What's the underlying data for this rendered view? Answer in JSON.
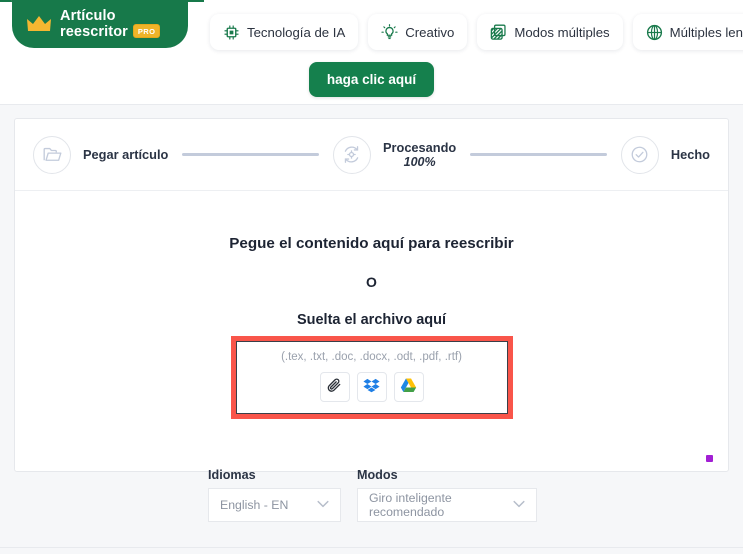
{
  "brand": {
    "crown_icon": "crown-icon",
    "line1": "Artículo",
    "line2": "reescritor",
    "badge": "PRO",
    "green": "#17794a",
    "badge_color": "#f0b429"
  },
  "header": {
    "pills": [
      {
        "icon": "ai-chip-icon",
        "label": "Tecnología de IA"
      },
      {
        "icon": "lightbulb-icon",
        "label": "Creativo"
      },
      {
        "icon": "layers-icon",
        "label": "Modos múltiples"
      },
      {
        "icon": "globe-icon",
        "label": "Múltiples lenguas"
      }
    ],
    "cta_label": "haga clic aquí",
    "cta_color": "#15804d"
  },
  "stepper": {
    "steps": [
      {
        "icon": "folder-icon",
        "label": "Pegar artículo",
        "sub": ""
      },
      {
        "icon": "processing-icon",
        "label": "Procesando",
        "sub": "100%"
      },
      {
        "icon": "check-circle-icon",
        "label": "Hecho",
        "sub": ""
      }
    ]
  },
  "dropzone": {
    "title": "Pegue el contenido aquí para reescribir",
    "or": "O",
    "subtitle": "Suelta el archivo aquí",
    "extensions": "(.tex, .txt, .doc, .docx, .odt, .pdf, .rtf)",
    "highlight_color": "#f9554a",
    "upload_buttons": [
      {
        "icon": "paperclip-icon",
        "name": "attach-file-button"
      },
      {
        "icon": "dropbox-icon",
        "name": "dropbox-button"
      },
      {
        "icon": "google-drive-icon",
        "name": "google-drive-button"
      }
    ],
    "marker_color": "#a21fd4"
  },
  "controls": {
    "language": {
      "label": "Idiomas",
      "value": "English - EN"
    },
    "mode": {
      "label": "Modos",
      "value": "Giro inteligente recomendado"
    }
  }
}
